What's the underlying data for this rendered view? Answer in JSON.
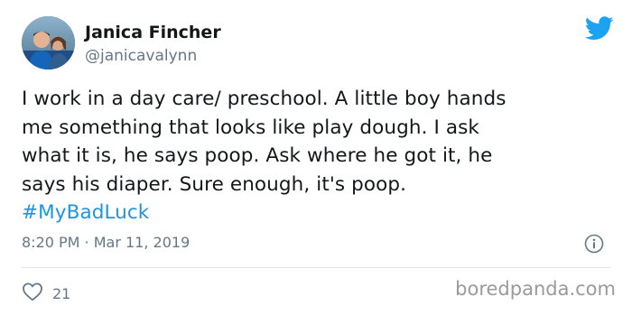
{
  "author": {
    "display_name": "Janica Fincher",
    "handle": "@janicavalynn"
  },
  "tweet": {
    "lines": [
      "I work in a day care/ preschool. A little boy hands",
      "me something that looks like play dough. I ask",
      "what it is, he says poop. Ask where he got it, he",
      "says his diaper. Sure enough, it's poop."
    ],
    "hashtag": "#MyBadLuck",
    "timestamp": "8:20 PM · Mar 11, 2019"
  },
  "engagement": {
    "like_count": "21"
  },
  "watermark": "boredpanda.com",
  "icons": {
    "brand": "twitter-bird-icon",
    "info": "info-icon",
    "like": "heart-icon"
  },
  "colors": {
    "twitter_blue": "#1da1f2",
    "hashtag": "#1b95e0",
    "secondary_text": "#657786",
    "primary_text": "#14171a"
  }
}
